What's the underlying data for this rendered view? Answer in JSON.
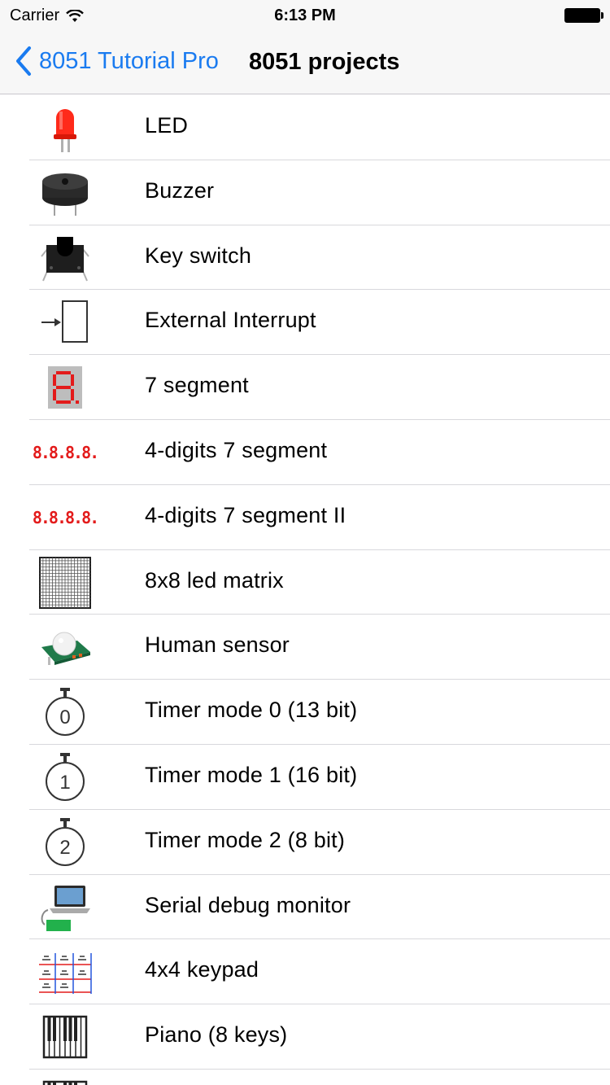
{
  "status_bar": {
    "carrier": "Carrier",
    "time": "6:13 PM"
  },
  "nav": {
    "back_label": "8051 Tutorial Pro",
    "title": "8051 projects"
  },
  "items": [
    {
      "label": "LED",
      "icon": "led-icon"
    },
    {
      "label": "Buzzer",
      "icon": "buzzer-icon"
    },
    {
      "label": "Key switch",
      "icon": "key-switch-icon"
    },
    {
      "label": "External Interrupt",
      "icon": "interrupt-icon"
    },
    {
      "label": "7 segment",
      "icon": "seven-segment-icon"
    },
    {
      "label": "4-digits 7 segment",
      "icon": "four-digit-segment-icon",
      "display": "8.8.8.8."
    },
    {
      "label": "4-digits 7 segment II",
      "icon": "four-digit-segment-icon",
      "display": "8.8.8.8."
    },
    {
      "label": "8x8 led matrix",
      "icon": "led-matrix-icon"
    },
    {
      "label": "Human sensor",
      "icon": "pir-sensor-icon"
    },
    {
      "label": "Timer mode 0 (13 bit)",
      "icon": "stopwatch-icon",
      "digit": "0"
    },
    {
      "label": "Timer mode 1 (16 bit)",
      "icon": "stopwatch-icon",
      "digit": "1"
    },
    {
      "label": "Timer mode 2 (8 bit)",
      "icon": "stopwatch-icon",
      "digit": "2"
    },
    {
      "label": "Serial debug monitor",
      "icon": "laptop-icon"
    },
    {
      "label": "4x4 keypad",
      "icon": "keypad-icon"
    },
    {
      "label": "Piano (8 keys)",
      "icon": "piano-icon"
    }
  ],
  "colors": {
    "accent": "#1a7bf0",
    "led_red": "#e31b1b"
  }
}
